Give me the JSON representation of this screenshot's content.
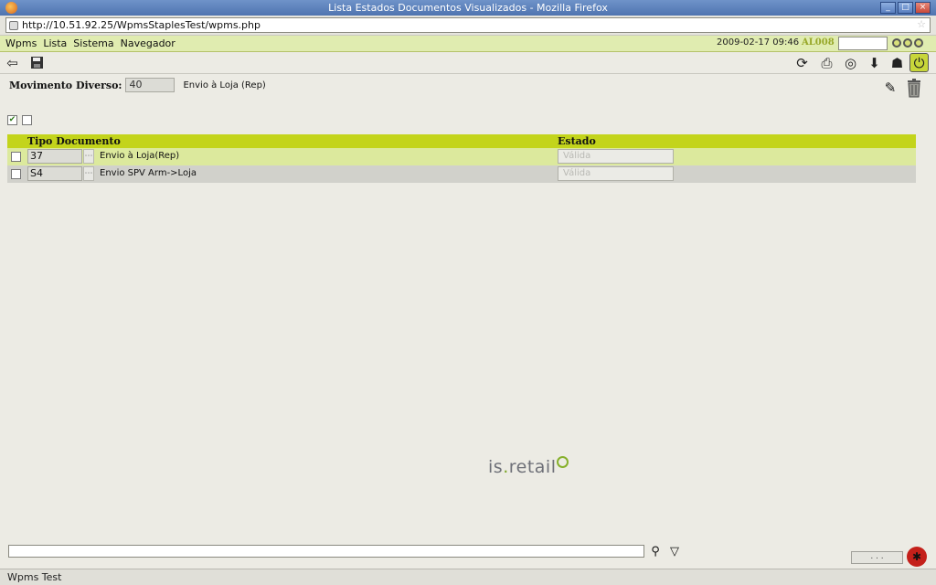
{
  "window": {
    "title": "Lista Estados Documentos Visualizados - Mozilla Firefox",
    "controls": [
      "_",
      "□",
      "×"
    ]
  },
  "browser": {
    "url": "http://10.51.92.25/WpmsStaplesTest/wpms.php",
    "status_text": "Wpms Test"
  },
  "menu": {
    "items": [
      "Wpms",
      "Lista",
      "Sistema",
      "Navegador"
    ],
    "datetime": "2009-02-17 09:46",
    "station": "AL008",
    "quick_input_value": ""
  },
  "toolbar": {
    "left_icons": [
      "back-arrow-icon",
      "save-icon"
    ],
    "right_icons": [
      "refresh-icon",
      "print-icon",
      "help-lifebuoy-icon",
      "export-icon",
      "user-icon",
      "power-icon"
    ]
  },
  "header": {
    "label": "Movimento Diverso:",
    "number": "40",
    "description": "Envio à Loja (Rep)"
  },
  "select_controls": {
    "select_all_checked": true,
    "select_none_checked": false
  },
  "grid": {
    "columns": [
      "Tipo Documento",
      "Estado"
    ],
    "rows": [
      {
        "code": "37",
        "description": "Envio à Loja(Rep)",
        "state": "Válida",
        "checked": false
      },
      {
        "code": "S4",
        "description": "Envio SPV Arm->Loja",
        "state": "Válida",
        "checked": false
      }
    ]
  },
  "brand": {
    "logo_prefix": "is",
    "logo_dot": ".",
    "logo_suffix": "retail",
    "accent_color": "#c3d41b"
  },
  "footer": {
    "command_value": "",
    "more_label": ". . ."
  }
}
